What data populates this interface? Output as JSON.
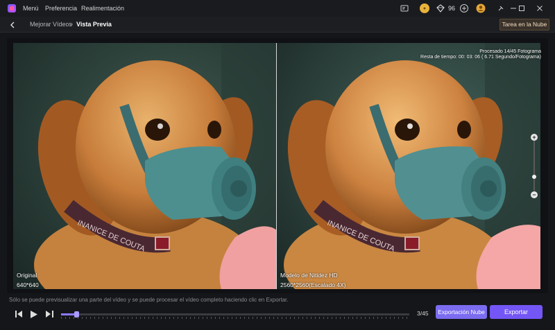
{
  "menu": {
    "items": [
      "Menú",
      "Preferencia",
      "Realimentación"
    ]
  },
  "titlebar": {
    "credits": "96",
    "icons": [
      "app-logo",
      "screen-record-icon",
      "coin-icon",
      "diamond-icon",
      "add-icon",
      "avatar-icon",
      "minimize-icon",
      "maximize-icon",
      "close-icon"
    ]
  },
  "nav": {
    "breadcrumb_parent": "Mejorar Vídeos",
    "breadcrumb_separator": ">",
    "breadcrumb_current": "Vista Previa",
    "cloud_task": "Tarea en la Nube"
  },
  "preview": {
    "left": {
      "title": "Original",
      "resolution": "640*640"
    },
    "right": {
      "title": "Modelo de Nitidez HD",
      "resolution": "2560*2560(Escalado 4X)"
    },
    "processed": "Procesado 14/45 Fotograma",
    "time_left": "Resta de tiempo: 00: 03: 06 ( 6.71 Segundo/Fotograma)",
    "collar_text": "INANICE DE COUTA"
  },
  "footer": {
    "notice": "Sólo se puede previsualizar una parte del vídeo y se puede procesar el vídeo completo haciendo clic en Exportar.",
    "frame_counter": "3/45",
    "cloud_export": "Exportación Nube",
    "export": "Exportar",
    "progress": 0.044
  },
  "colors": {
    "accent": "#7456f6",
    "cloud_export": "#7b6cf0",
    "background": "#151619"
  }
}
